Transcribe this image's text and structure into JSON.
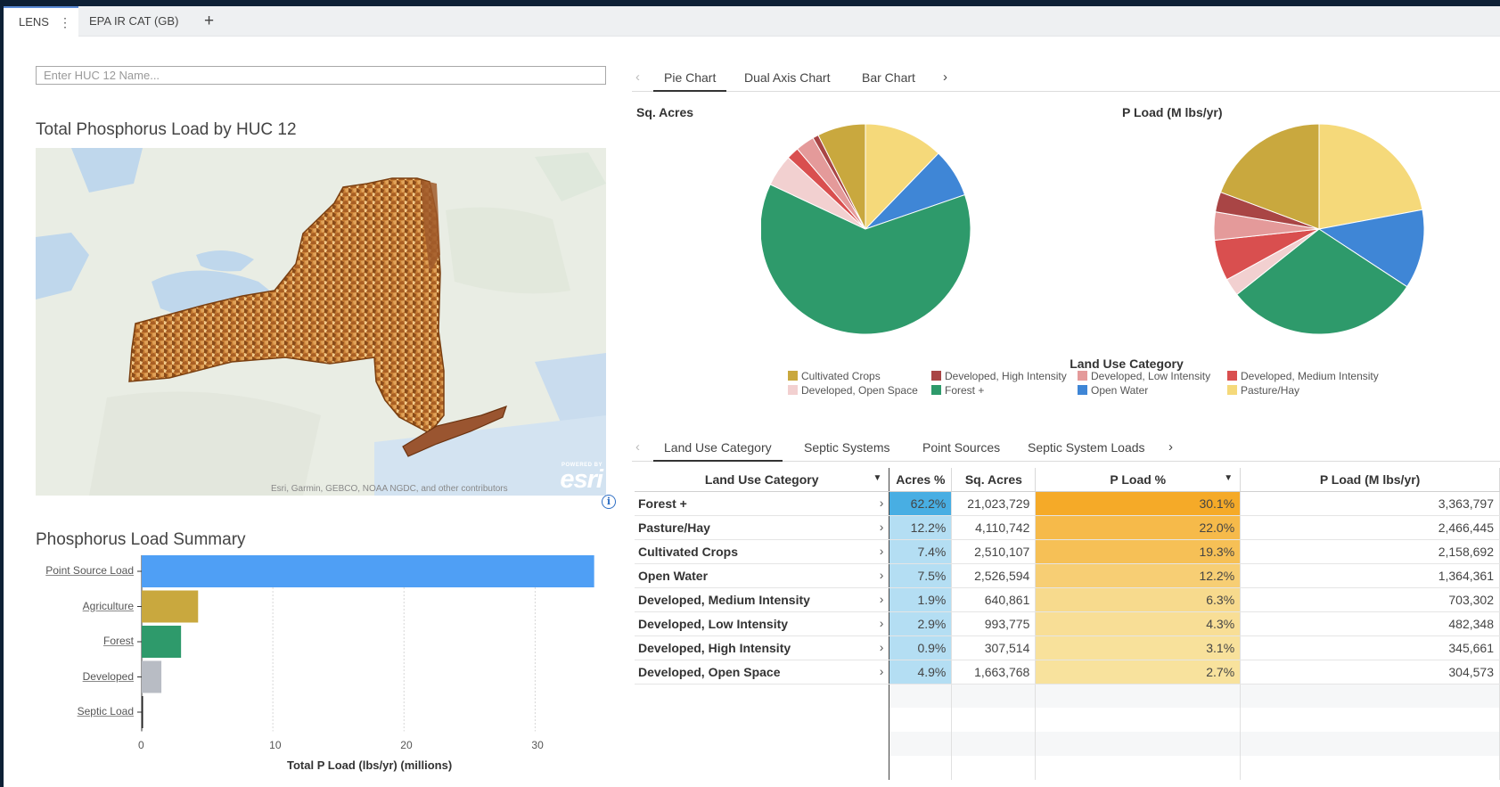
{
  "tabs": {
    "lens": "LENS",
    "kebab": "⋮",
    "epa": "EPA IR CAT (GB)",
    "add": "+"
  },
  "search": {
    "placeholder": "Enter HUC 12 Name..."
  },
  "map": {
    "title": "Total Phosphorus Load by HUC 12",
    "attribution": "Esri, Garmin, GEBCO, NOAA NGDC, and other contributors",
    "logo_top": "POWERED BY",
    "logo_main": "esri",
    "info": "i"
  },
  "bar_chart": {
    "title": "Phosphorus Load Summary"
  },
  "chart_tabs": {
    "prev": "‹",
    "next": "›",
    "items": [
      "Pie Chart",
      "Dual Axis Chart",
      "Bar Chart"
    ]
  },
  "data_tabs": {
    "prev": "‹",
    "next": "›",
    "items": [
      "Land Use Category",
      "Septic Systems",
      "Point Sources",
      "Septic System Loads"
    ]
  },
  "pies": {
    "left_title": "Sq. Acres",
    "right_title": "P Load (M lbs/yr)"
  },
  "legend": {
    "title": "Land Use Category",
    "items": [
      {
        "label": "Cultivated Crops",
        "color": "#c9a83e"
      },
      {
        "label": "Developed, High Intensity",
        "color": "#a94545"
      },
      {
        "label": "Developed, Low Intensity",
        "color": "#e49a9a"
      },
      {
        "label": "Developed, Medium Intensity",
        "color": "#d94f4f"
      },
      {
        "label": "Developed, Open Space",
        "color": "#f2d0d0"
      },
      {
        "label": "Forest +",
        "color": "#2e9a6b"
      },
      {
        "label": "Open Water",
        "color": "#3f86d6"
      },
      {
        "label": "Pasture/Hay",
        "color": "#f5d97a"
      }
    ]
  },
  "table": {
    "headers": [
      "Land Use Category",
      "Acres %",
      "Sq. Acres",
      "P Load %",
      "P Load (M lbs/yr)"
    ],
    "rows": [
      {
        "cat": "Forest +",
        "acres_pct": "62.2%",
        "sq_acres": "21,023,729",
        "pload_pct": "30.1%",
        "pload": "3,363,797"
      },
      {
        "cat": "Pasture/Hay",
        "acres_pct": "12.2%",
        "sq_acres": "4,110,742",
        "pload_pct": "22.0%",
        "pload": "2,466,445"
      },
      {
        "cat": "Cultivated Crops",
        "acres_pct": "7.4%",
        "sq_acres": "2,510,107",
        "pload_pct": "19.3%",
        "pload": "2,158,692"
      },
      {
        "cat": "Open Water",
        "acres_pct": "7.5%",
        "sq_acres": "2,526,594",
        "pload_pct": "12.2%",
        "pload": "1,364,361"
      },
      {
        "cat": "Developed, Medium Intensity",
        "acres_pct": "1.9%",
        "sq_acres": "640,861",
        "pload_pct": "6.3%",
        "pload": "703,302"
      },
      {
        "cat": "Developed, Low Intensity",
        "acres_pct": "2.9%",
        "sq_acres": "993,775",
        "pload_pct": "4.3%",
        "pload": "482,348"
      },
      {
        "cat": "Developed, High Intensity",
        "acres_pct": "0.9%",
        "sq_acres": "307,514",
        "pload_pct": "3.1%",
        "pload": "345,661"
      },
      {
        "cat": "Developed, Open Space",
        "acres_pct": "4.9%",
        "sq_acres": "1,663,768",
        "pload_pct": "2.7%",
        "pload": "304,573"
      }
    ]
  },
  "chart_data": [
    {
      "type": "bar",
      "orientation": "horizontal",
      "title": "Phosphorus Load Summary",
      "categories": [
        "Point Source Load",
        "Agriculture",
        "Forest",
        "Developed",
        "Septic Load"
      ],
      "values": [
        34.5,
        4.3,
        3.0,
        1.5,
        0.05
      ],
      "colors": [
        "#4f9ff5",
        "#c9a83e",
        "#2e9a6b",
        "#b8bcc4",
        "#222222"
      ],
      "xlabel": "Total P Load (lbs/yr) (millions)",
      "xlim": [
        0,
        35
      ],
      "ticks": [
        0,
        10,
        20,
        30
      ],
      "grid": true
    },
    {
      "type": "pie",
      "title": "Sq. Acres",
      "labels": [
        "Pasture/Hay",
        "Open Water",
        "Forest +",
        "Developed, Open Space",
        "Developed, Medium Intensity",
        "Developed, Low Intensity",
        "Developed, High Intensity",
        "Cultivated Crops"
      ],
      "values": [
        12.2,
        7.5,
        62.2,
        4.9,
        1.9,
        2.9,
        0.9,
        7.4
      ]
    },
    {
      "type": "pie",
      "title": "P Load (M lbs/yr)",
      "labels": [
        "Pasture/Hay",
        "Open Water",
        "Forest +",
        "Developed, Open Space",
        "Developed, Medium Intensity",
        "Developed, Low Intensity",
        "Developed, High Intensity",
        "Cultivated Crops"
      ],
      "values": [
        2466445,
        1364361,
        3363797,
        304573,
        703302,
        482348,
        345661,
        2158692
      ]
    }
  ]
}
